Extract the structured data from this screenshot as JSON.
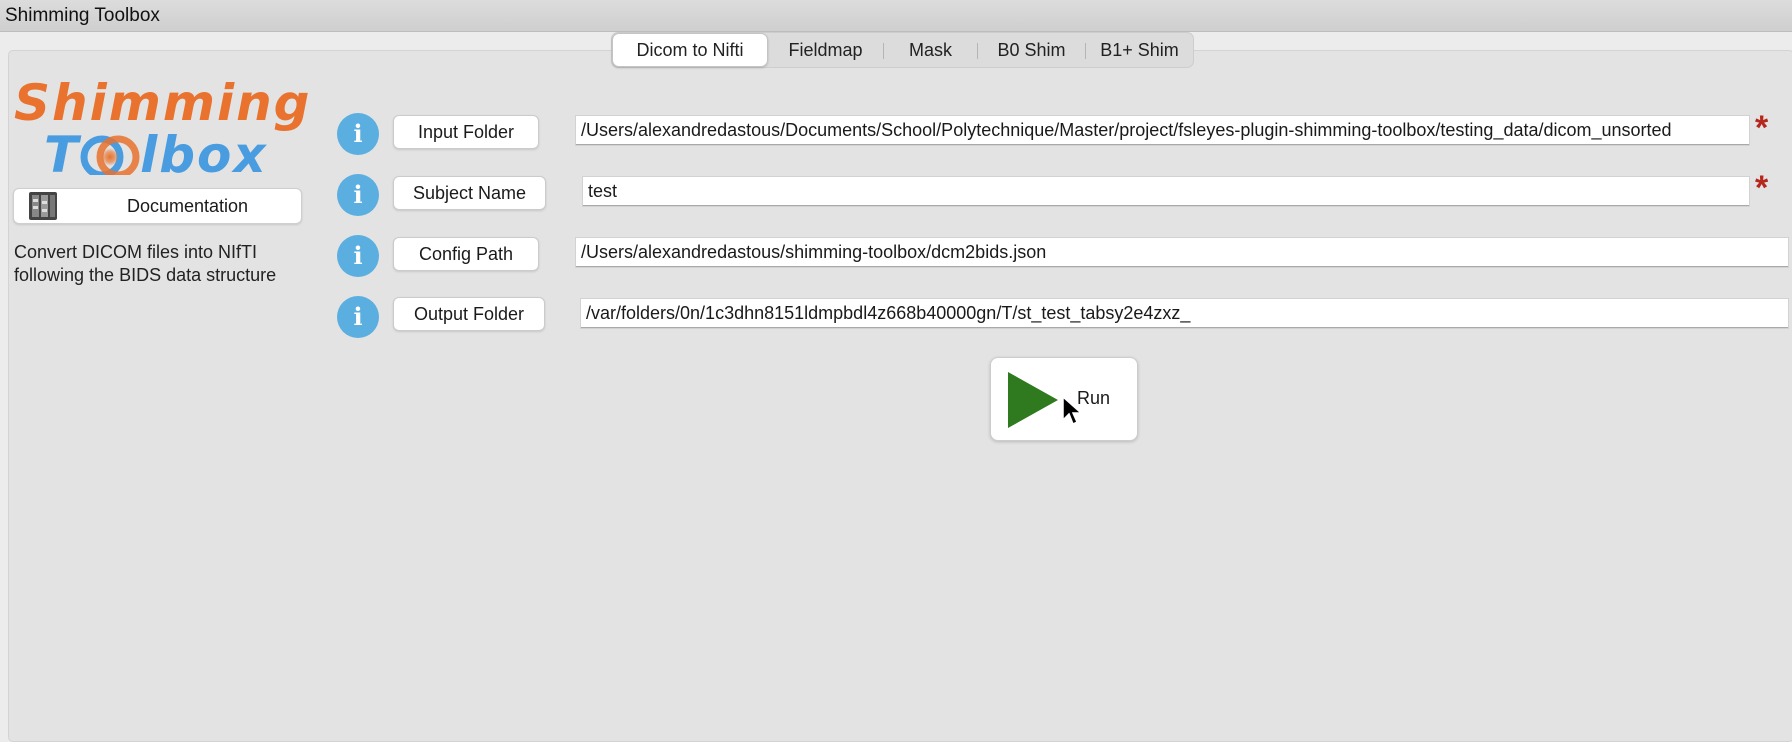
{
  "window": {
    "title": "Shimming Toolbox"
  },
  "tabs": [
    {
      "label": "Dicom to Nifti",
      "active": true
    },
    {
      "label": "Fieldmap",
      "active": false
    },
    {
      "label": "Mask",
      "active": false
    },
    {
      "label": "B0 Shim",
      "active": false
    },
    {
      "label": "B1+ Shim",
      "active": false
    }
  ],
  "logo": {
    "line1": "Shimming",
    "line2_prefix": "T",
    "line2_suffix": "lbox"
  },
  "sidebar": {
    "documentation_label": "Documentation",
    "description": "Convert DICOM files into NIfTI following the BIDS data structure"
  },
  "form": {
    "rows": [
      {
        "label": "Input Folder",
        "value": "/Users/alexandredastous/Documents/School/Polytechnique/Master/project/fsleyes-plugin-shimming-toolbox/testing_data/dicom_unsorted",
        "required": true
      },
      {
        "label": "Subject Name",
        "value": "test",
        "required": true
      },
      {
        "label": "Config Path",
        "value": "/Users/alexandredastous/shimming-toolbox/dcm2bids.json",
        "required": false
      },
      {
        "label": "Output Folder",
        "value": "/var/folders/0n/1c3dhn8151ldmpbdl4z668b40000gn/T/st_test_tabsy2e4zxz_",
        "required": false
      }
    ],
    "required_marker": "*",
    "info_glyph": "i"
  },
  "run": {
    "label": "Run"
  },
  "colors": {
    "accent_blue": "#5aaee0",
    "logo_orange": "#e8722e",
    "logo_blue": "#4a9ce0",
    "run_green": "#2f7a1f",
    "required_red": "#b5281d"
  },
  "icons": {
    "info": "info-icon",
    "documentation": "book-icon",
    "run": "play-icon",
    "cursor": "mouse-pointer-icon"
  }
}
